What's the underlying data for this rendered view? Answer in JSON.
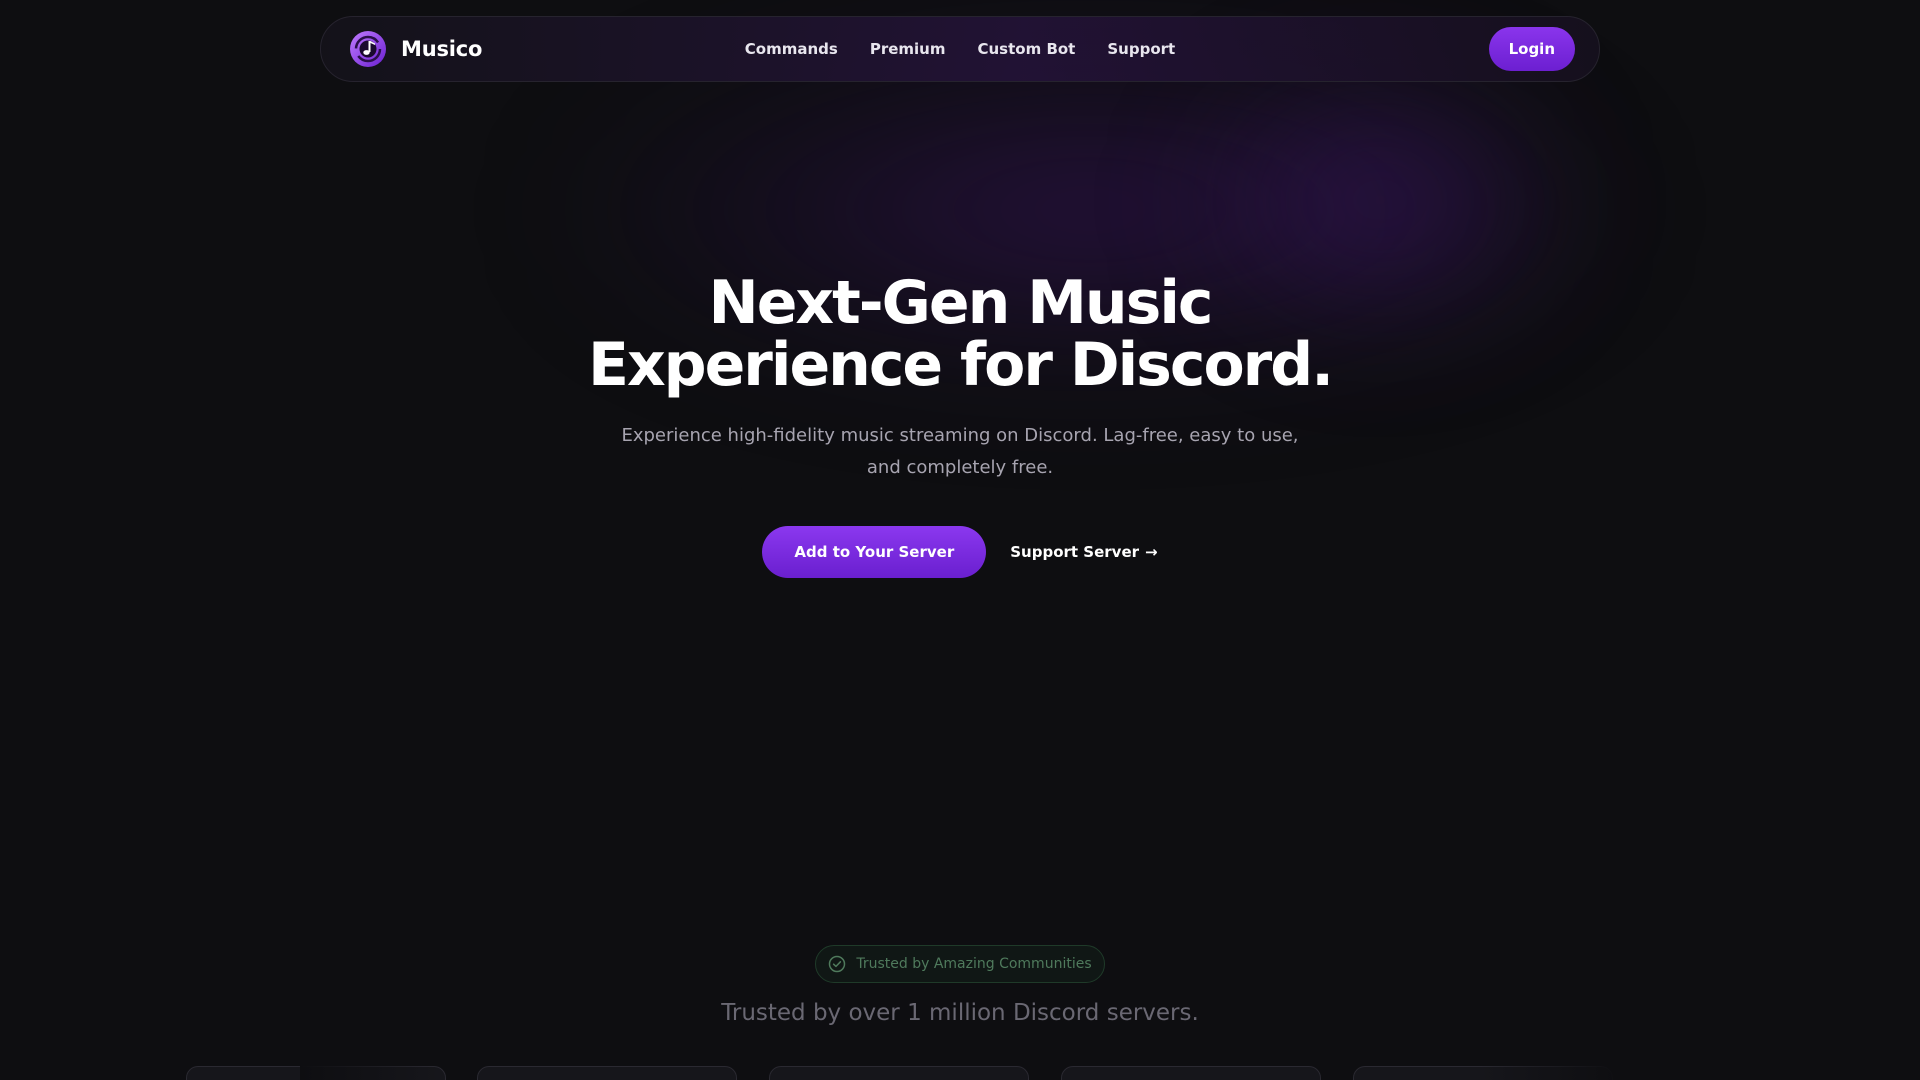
{
  "nav": {
    "brand": "Musico",
    "links": [
      "Commands",
      "Premium",
      "Custom Bot",
      "Support"
    ],
    "login": "Login"
  },
  "hero": {
    "title_line1": "Next-Gen Music",
    "title_line2": "Experience for Discord.",
    "subtitle_line1": "Experience high-fidelity music streaming on Discord. Lag-free, easy to use,",
    "subtitle_line2": "and completely free.",
    "primary_cta": "Add to Your Server",
    "secondary_cta": "Support Server",
    "secondary_arrow": "→"
  },
  "trusted": {
    "badge": "Trusted by Amazing Communities",
    "headline": "Trusted by over 1 million Discord servers."
  },
  "colors": {
    "accent": "#7c2ae8",
    "background": "#0e0e11",
    "badge_green": "#4f7a5c"
  },
  "icons": {
    "brand": "music-note-disc-icon",
    "badge": "check-circle-icon"
  }
}
